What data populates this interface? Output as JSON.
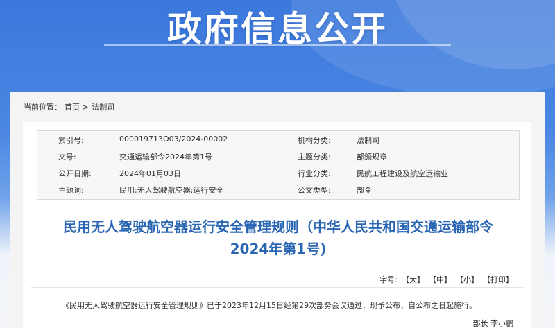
{
  "banner": {
    "title": "政府信息公开"
  },
  "breadcrumb": {
    "prefix": "当前位置：",
    "home": "首页",
    "sep": ">",
    "current": "法制司"
  },
  "meta": {
    "rows": [
      {
        "k1": "索引号:",
        "v1": "000019713O03/2024-00002",
        "k2": "机构分类:",
        "v2": "法制司"
      },
      {
        "k1": "文号:",
        "v1": "交通运输部令2024年第1号",
        "k2": "主题分类:",
        "v2": "部颁规章"
      },
      {
        "k1": "公开日期:",
        "v1": "2024年01月03日",
        "k2": "行业分类:",
        "v2": "民航工程建设及航空运输业"
      },
      {
        "k1": "主题词:",
        "v1": "民用;无人驾驶航空器;运行安全",
        "k2": "公文类型:",
        "v2": "部令"
      }
    ]
  },
  "doc": {
    "title_line1": "民用无人驾驶航空器运行安全管理规则（中华人民共和国交通运输部令",
    "title_line2": "2024年第1号)",
    "font_label": "字号:",
    "font_large": "【大】",
    "font_medium": "【中】",
    "font_small": "【小】",
    "print": "【打印】",
    "body": "《民用无人驾驶航空器运行安全管理规则》已于2023年12月15日经第29次部务会议通过，现予公布，自公布之日起施行。",
    "sign": "部长  李小鹏"
  }
}
